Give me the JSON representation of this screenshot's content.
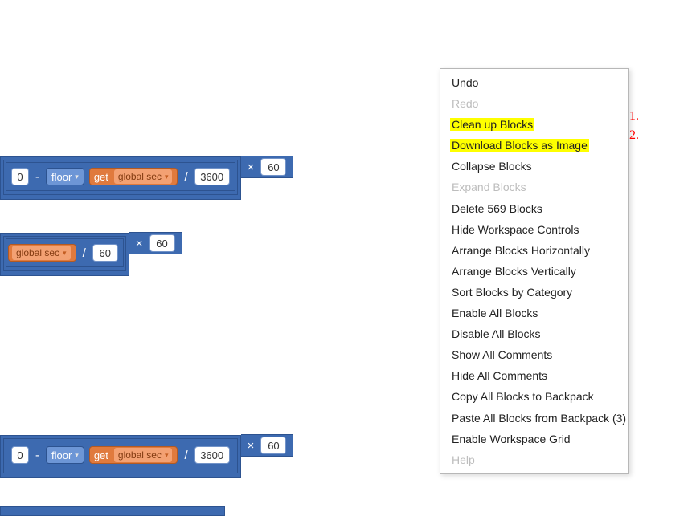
{
  "menu": {
    "items": [
      {
        "label": "Undo",
        "disabled": false,
        "highlight": false
      },
      {
        "label": "Redo",
        "disabled": true,
        "highlight": false
      },
      {
        "label": "Clean up Blocks",
        "disabled": false,
        "highlight": true
      },
      {
        "label": "Download Blocks as Image",
        "disabled": false,
        "highlight": true
      },
      {
        "label": "Collapse Blocks",
        "disabled": false,
        "highlight": false
      },
      {
        "label": "Expand Blocks",
        "disabled": true,
        "highlight": false
      },
      {
        "label": "Delete 569 Blocks",
        "disabled": false,
        "highlight": false
      },
      {
        "label": "Hide Workspace Controls",
        "disabled": false,
        "highlight": false
      },
      {
        "label": "Arrange Blocks Horizontally",
        "disabled": false,
        "highlight": false
      },
      {
        "label": "Arrange Blocks Vertically",
        "disabled": false,
        "highlight": false
      },
      {
        "label": "Sort Blocks by Category",
        "disabled": false,
        "highlight": false
      },
      {
        "label": "Enable All Blocks",
        "disabled": false,
        "highlight": false
      },
      {
        "label": "Disable All Blocks",
        "disabled": false,
        "highlight": false
      },
      {
        "label": "Show All Comments",
        "disabled": false,
        "highlight": false
      },
      {
        "label": "Hide All Comments",
        "disabled": false,
        "highlight": false
      },
      {
        "label": "Copy All Blocks to Backpack",
        "disabled": false,
        "highlight": false
      },
      {
        "label": "Paste All Blocks from Backpack (3)",
        "disabled": false,
        "highlight": false
      },
      {
        "label": "Enable Workspace Grid",
        "disabled": false,
        "highlight": false
      },
      {
        "label": "Help",
        "disabled": true,
        "highlight": false
      }
    ]
  },
  "annotations": {
    "a1": "1.",
    "a2": "2."
  },
  "blocks": {
    "floor_label": "floor",
    "get_label": "get",
    "global_sec": "global sec",
    "zero": "0",
    "minus": "-",
    "divide": "/",
    "times": "×",
    "n3600": "3600",
    "n60": "60",
    "dropdown_tri": "▾"
  }
}
